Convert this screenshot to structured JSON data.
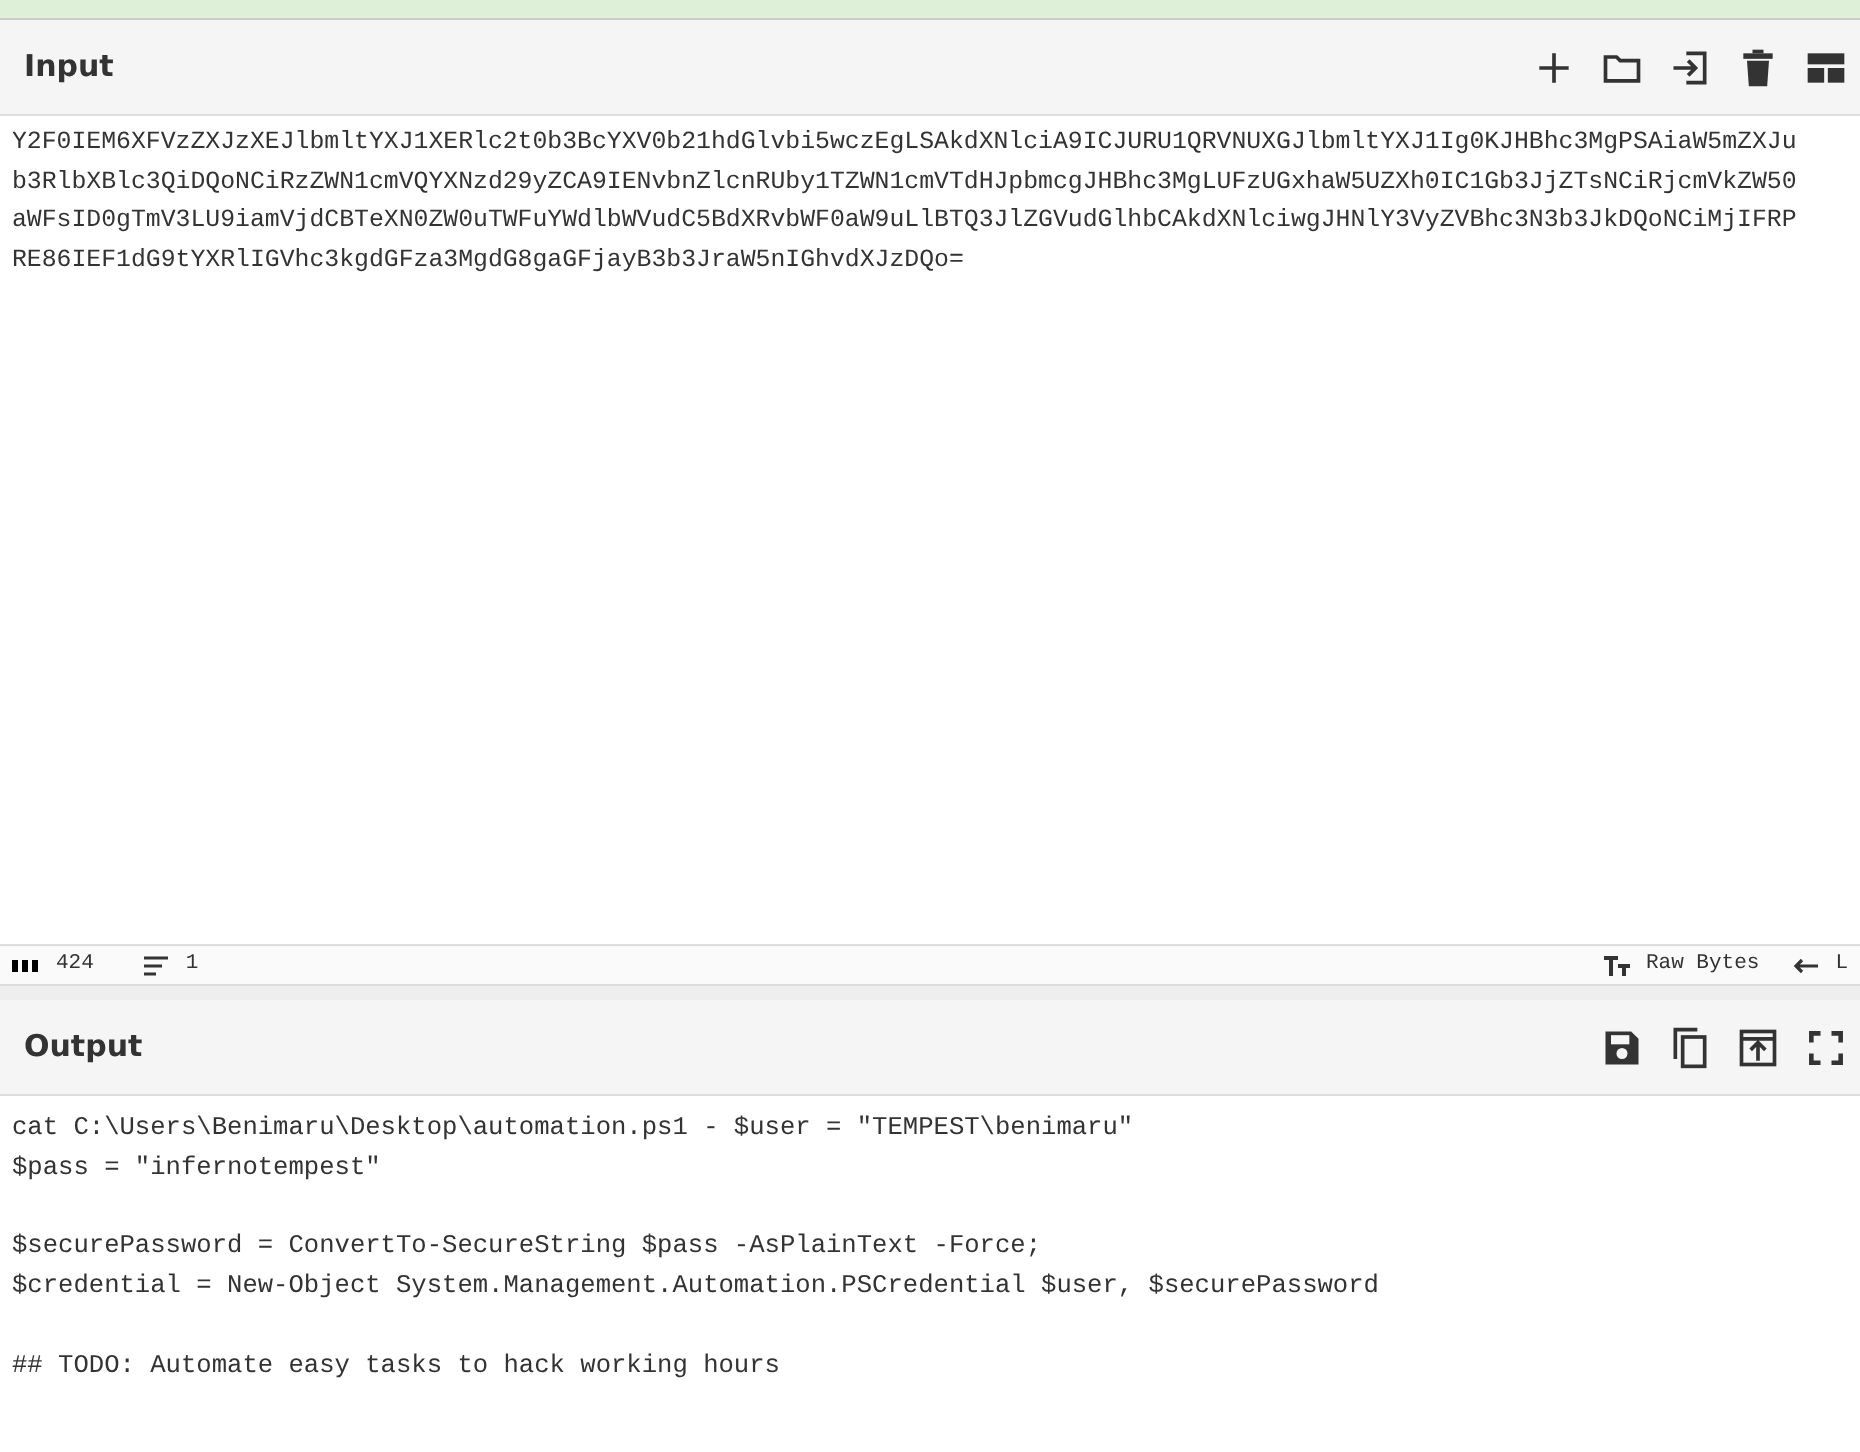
{
  "input": {
    "title": "Input",
    "lines": [
      "Y2F0IEM6XFVzZXJzXEJlbmltYXJ1XERlc2t0b3BcYXV0b21hdGlvbi5wczEgLSAkdXNlciA9ICJURU1QRVNUXGJlbmltYXJ1Ig0KJHBhc3MgPSAiaW5mZXJu",
      "b3RlbXBlc3QiDQoNCiRzZWN1cmVQYXNzd29yZCA9IENvbnZlcnRUby1TZWN1cmVTdHJpbmcgJHBhc3MgLUFzUGxhaW5UZXh0IC1Gb3JjZTsNCiRjcmVkZW50",
      "aWFsID0gTmV3LU9iamVjdCBTeXN0ZW0uTWFuYWdlbWVudC5BdXRvbWF0aW9uLlBTQ3JlZGVudGlhbCAkdXNlciwgJHNlY3VyZVBhc3N3b3JkDQoNCiMjIFRP",
      "RE86IEF1dG9tYXRlIGVhc3kgdGFza3MgdG8gaGFjayB3b3JraW5nIGhvdXJzDQo="
    ]
  },
  "status_bar": {
    "length": "424",
    "line_count": "1",
    "encoding": "Raw Bytes",
    "eol": "L"
  },
  "output": {
    "title": "Output",
    "text": "cat C:\\Users\\Benimaru\\Desktop\\automation.ps1 - $user = \"TEMPEST\\benimaru\"\n$pass = \"infernotempest\"\n\n$securePassword = ConvertTo-SecureString $pass -AsPlainText -Force;\n$credential = New-Object System.Management.Automation.PSCredential $user, $securePassword\n\n## TODO: Automate easy tasks to hack working hours"
  }
}
